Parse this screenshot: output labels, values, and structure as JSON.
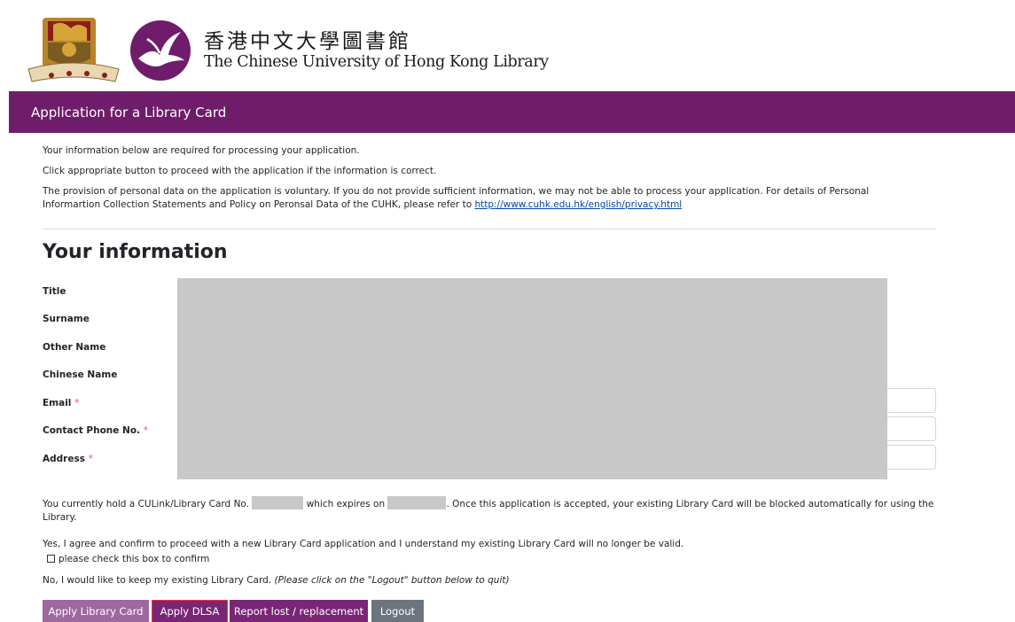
{
  "header": {
    "logo_cn": "香港中文大學圖書館",
    "logo_en": "The Chinese University of Hong Kong Library"
  },
  "title_bar": {
    "text": "Application for a Library Card"
  },
  "intro": {
    "p1": "Your information below are required for processing your application.",
    "p2": "Click appropriate button to proceed with the application if the information is correct.",
    "p3_text": "The provision of personal data on the application is voluntary. If you do not provide sufficient information, we may not be able to process your application. For details of Personal Informartion Collection Statements and Policy on Peronsal Data of the CUHK, please refer to ",
    "p3_link": "http://www.cuhk.edu.hk/english/privacy.html"
  },
  "section_title": "Your information",
  "fields": {
    "title": "Title",
    "surname": "Surname",
    "other_name": "Other Name",
    "chinese_name": "Chinese Name",
    "email": "Email",
    "phone": "Contact Phone No.",
    "address": "Address",
    "required_mark": "*"
  },
  "notice": {
    "card_pre": "You currently hold a CULink/Library Card No.",
    "card_mid": "which expires on",
    "card_post": ". Once this application is accepted, your existing Library Card will be blocked automatically for using the Library.",
    "agree": "Yes, I agree and confirm to proceed with a new Library Card application and I understand my existing Library Card will no longer be valid.",
    "checkbox_label": "please check this box to confirm",
    "keep_pre": "No, I would like to keep my existing Library Card. ",
    "keep_italic": "(Please click on the \"Logout\" button below to quit)"
  },
  "buttons": {
    "apply_card": "Apply Library Card",
    "apply_dlsa": "Apply DLSA",
    "report_lost": "Report lost / replacement",
    "logout": "Logout"
  },
  "colors": {
    "brand_purple": "#6f1d6b",
    "button_purple": "#7a2676",
    "button_light_purple": "#a067a0",
    "button_grey": "#6c757d",
    "focus_red": "#e8363a"
  }
}
